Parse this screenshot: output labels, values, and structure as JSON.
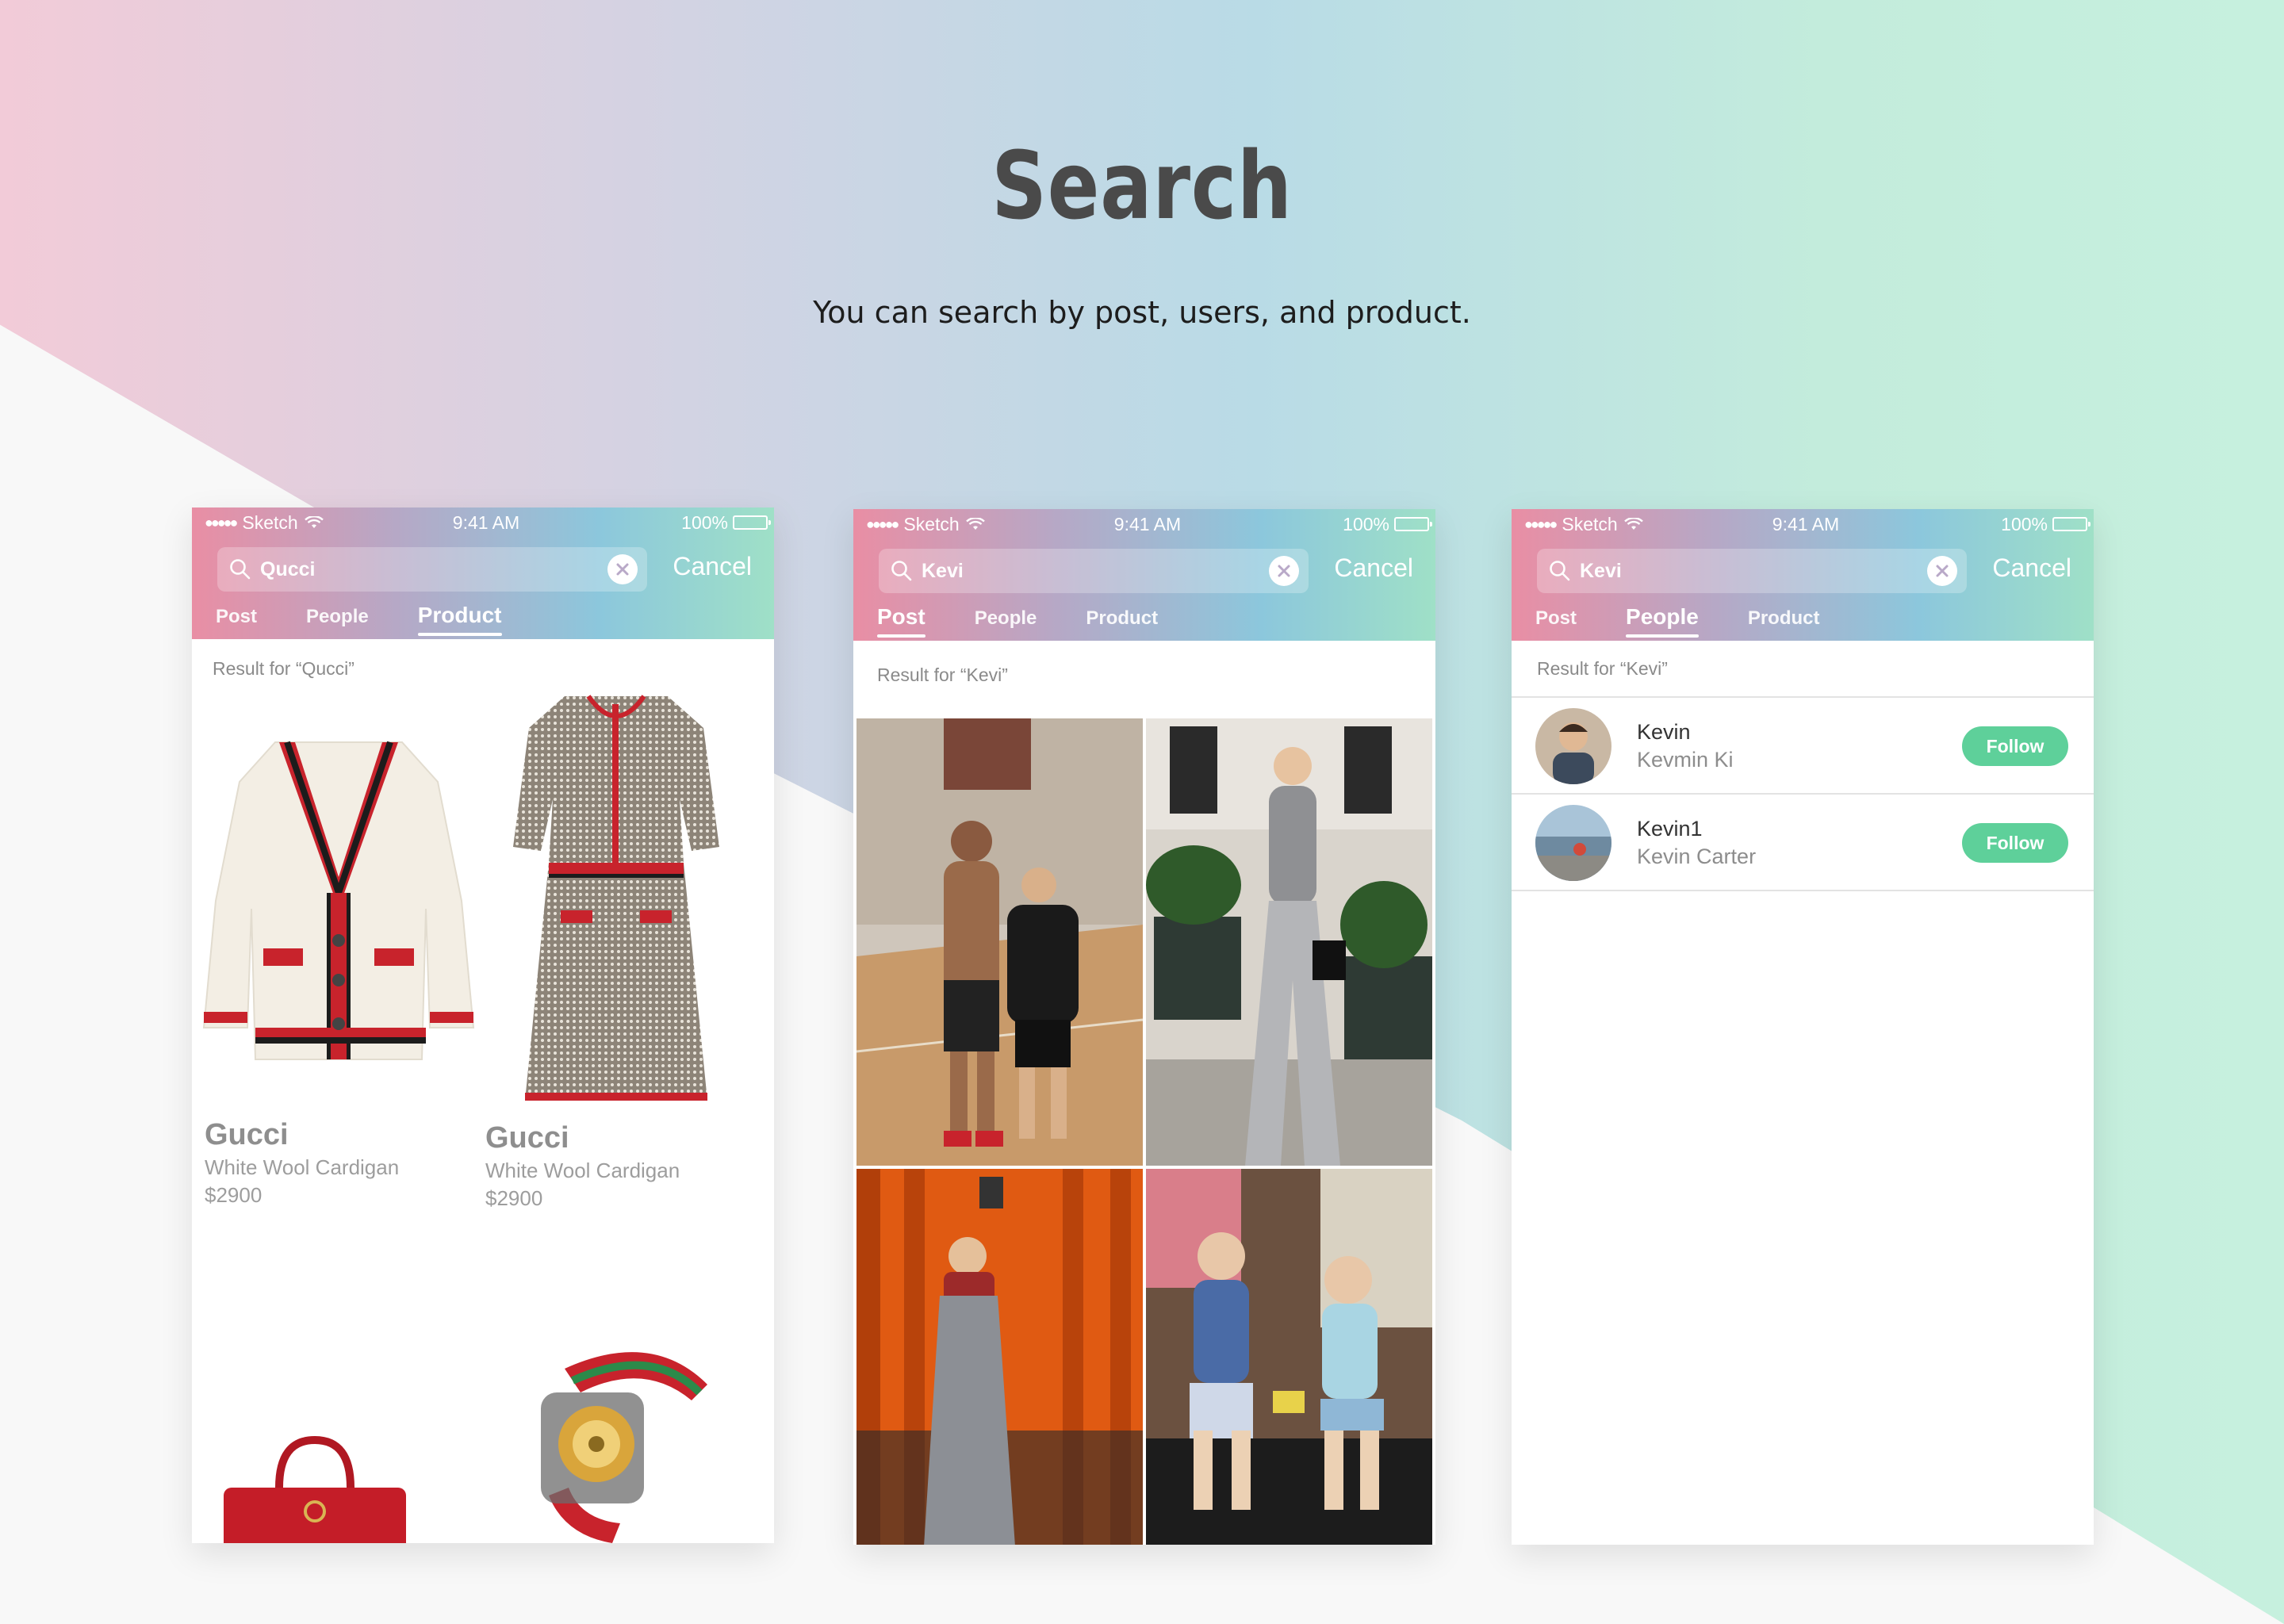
{
  "page": {
    "title": "Search",
    "subtitle": "You can search by post, users, and product."
  },
  "status_bar": {
    "carrier": "Sketch",
    "signal": "●●●●●",
    "time": "9:41 AM",
    "battery": "100%"
  },
  "colors": {
    "follow": "#5ed09a",
    "header_gradient_start": "#e98ea4",
    "header_gradient_end": "#9fe0c7",
    "title": "#4a4a4a"
  },
  "screens": [
    {
      "query": "Qucci",
      "cancel_label": "Cancel",
      "tabs": [
        "Post",
        "People",
        "Product"
      ],
      "active_tab": "Product",
      "result_label": "Result for “Qucci”",
      "products": [
        {
          "brand": "Gucci",
          "name": "White Wool Cardigan",
          "price": "$2900",
          "icon": "cardigan-image"
        },
        {
          "brand": "Gucci",
          "name": "White Wool Cardigan",
          "price": "$2900",
          "icon": "dress-image"
        },
        {
          "icon": "handbag-image"
        },
        {
          "icon": "watch-image"
        }
      ]
    },
    {
      "query": "Kevi",
      "cancel_label": "Cancel",
      "tabs": [
        "Post",
        "People",
        "Product"
      ],
      "active_tab": "Post",
      "result_label": "Result for “Kevi”",
      "posts": [
        {
          "icon": "basketball-court-photo"
        },
        {
          "icon": "street-fashion-photo"
        },
        {
          "icon": "torii-gates-photo"
        },
        {
          "icon": "two-friends-photo"
        }
      ]
    },
    {
      "query": "Kevi",
      "cancel_label": "Cancel",
      "tabs": [
        "Post",
        "People",
        "Product"
      ],
      "active_tab": "People",
      "result_label": "Result for “Kevi”",
      "people": [
        {
          "username": "Kevin",
          "full_name": "Kevmin Ki",
          "follow_label": "Follow",
          "icon": "avatar-photo"
        },
        {
          "username": "Kevin1",
          "full_name": "Kevin Carter",
          "follow_label": "Follow",
          "icon": "avatar-photo"
        }
      ]
    }
  ]
}
